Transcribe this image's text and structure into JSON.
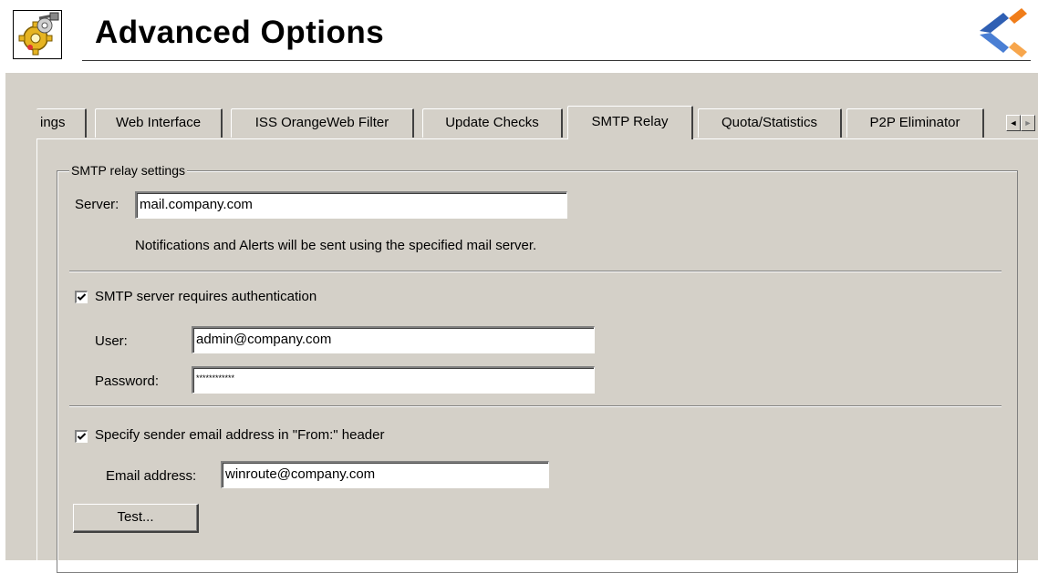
{
  "header": {
    "title": "Advanced Options",
    "app_icon": "gear-tools-icon",
    "logo": "brand-chevron-logo"
  },
  "tabs": {
    "items": [
      {
        "label": "ings"
      },
      {
        "label": "Web Interface"
      },
      {
        "label": "ISS OrangeWeb Filter"
      },
      {
        "label": "Update Checks"
      },
      {
        "label": "SMTP Relay",
        "active": true
      },
      {
        "label": "Quota/Statistics"
      },
      {
        "label": "P2P Eliminator"
      }
    ],
    "scroll_left": "◄",
    "scroll_right": "►"
  },
  "smtp": {
    "group_title": "SMTP relay settings",
    "server_label": "Server:",
    "server_value": "mail.company.com",
    "notice": "Notifications and Alerts will be sent using the specified mail server.",
    "auth_checkbox_label": "SMTP server requires authentication",
    "auth_checked": true,
    "user_label": "User:",
    "user_value": "admin@company.com",
    "password_label": "Password:",
    "password_value": "************",
    "from_checkbox_label": "Specify sender email address in \"From:\" header",
    "from_checked": true,
    "email_label": "Email address:",
    "email_value": "winroute@company.com",
    "test_button": "Test..."
  },
  "colors": {
    "dialog_bg": "#d4d0c8",
    "logo_blue": "#2f5fb3",
    "logo_orange": "#f07d1a"
  }
}
